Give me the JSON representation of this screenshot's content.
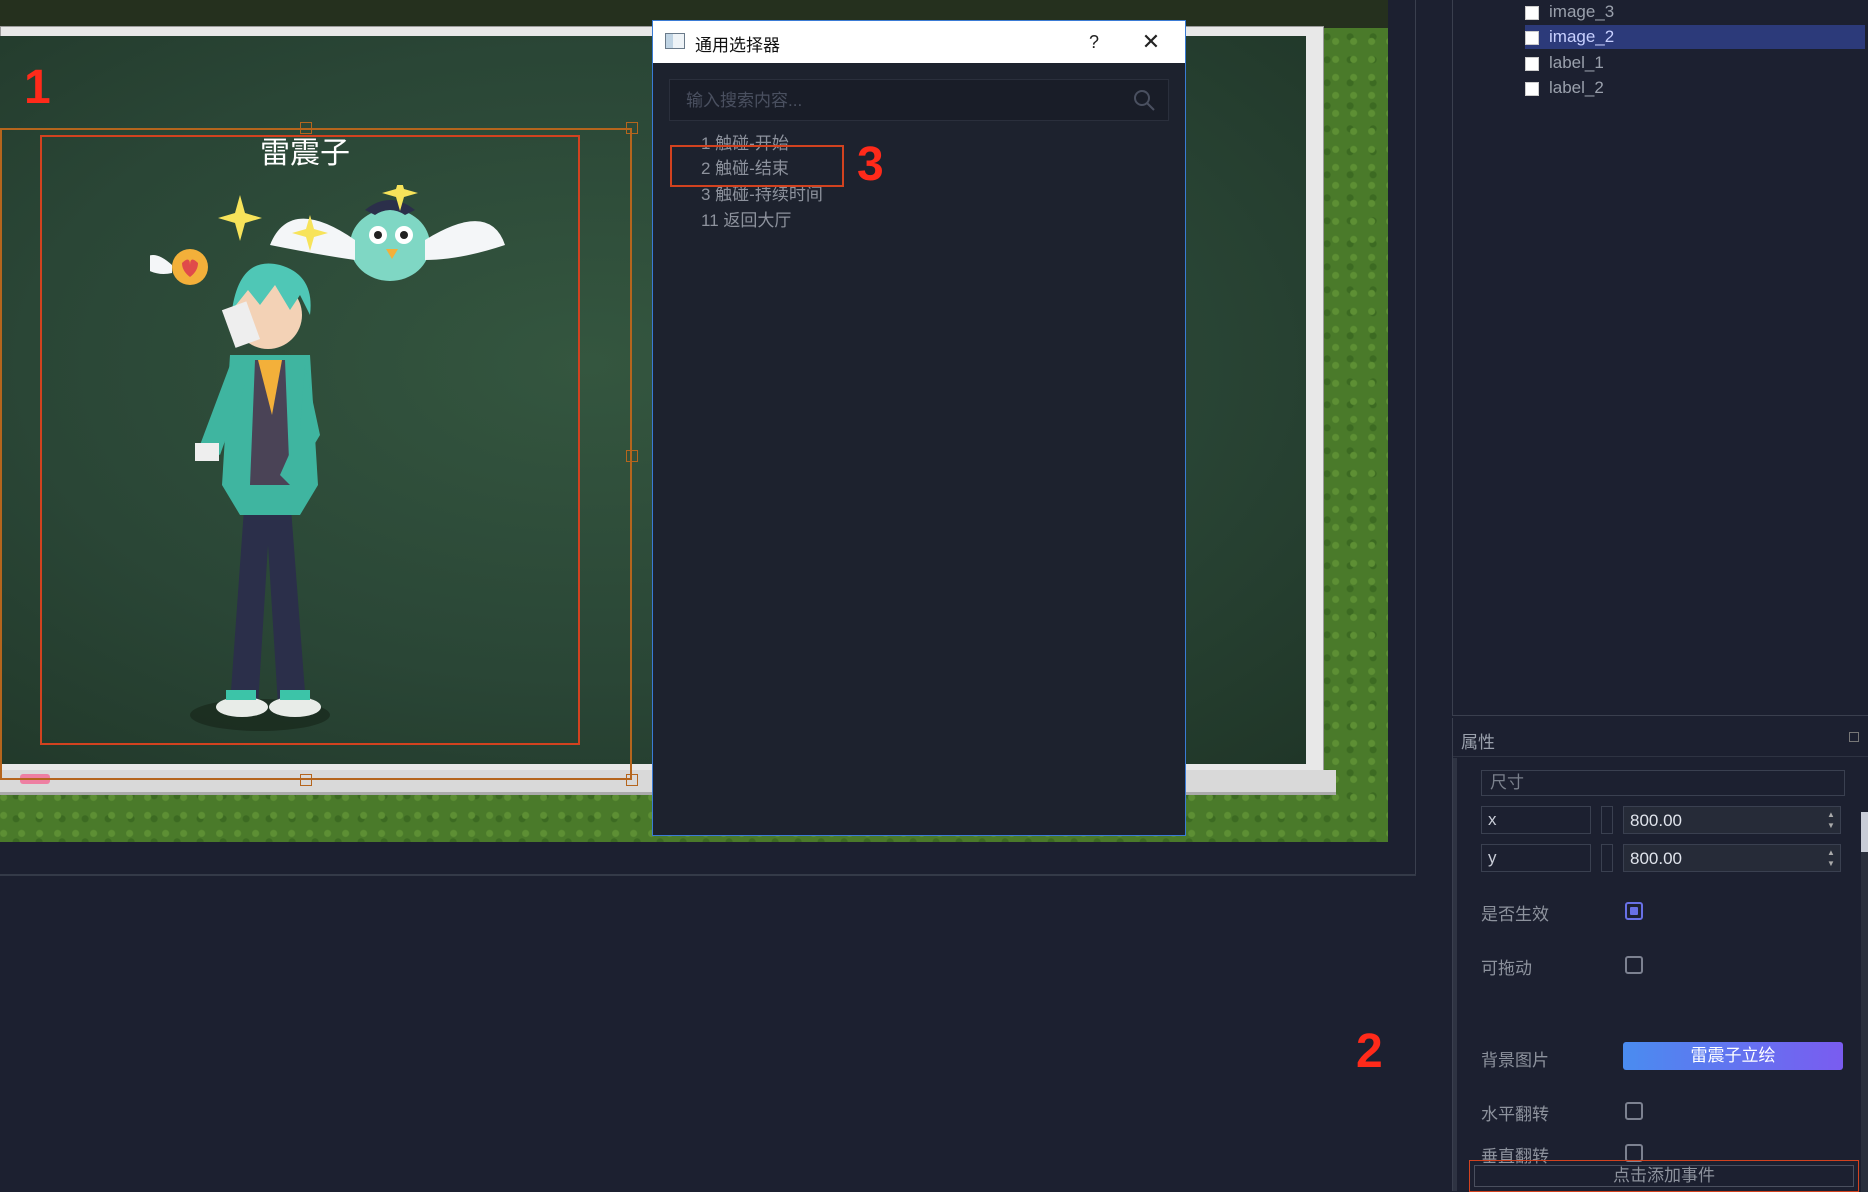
{
  "scene": {
    "character_name": "雷震子",
    "marker_1": "1"
  },
  "dialog": {
    "title": "通用选择器",
    "help_label": "?",
    "close_label": "✕",
    "search_placeholder": "输入搜索内容...",
    "items": [
      {
        "label": "1 触碰-开始"
      },
      {
        "label": "2 触碰-结束"
      },
      {
        "label": "3 触碰-持续时间"
      },
      {
        "label": "11 返回大厅"
      }
    ],
    "marker_3": "3"
  },
  "tree": {
    "items": [
      {
        "label": "image_3",
        "selected": false
      },
      {
        "label": "image_2",
        "selected": true
      },
      {
        "label": "label_1",
        "selected": false
      },
      {
        "label": "label_2",
        "selected": false
      }
    ]
  },
  "properties": {
    "title": "属性",
    "size_group": "尺寸",
    "x_label": "x",
    "x_value": "800.00",
    "y_label": "y",
    "y_value": "800.00",
    "enabled_label": "是否生效",
    "enabled": true,
    "draggable_label": "可拖动",
    "draggable": false,
    "bg_image_label": "背景图片",
    "bg_image_value": "雷震子立绘",
    "flip_h_label": "水平翻转",
    "flip_h": false,
    "flip_v_label": "垂直翻转",
    "flip_v": false,
    "add_event_label": "点击添加事件",
    "marker_2": "2"
  },
  "colors": {
    "accent": "#6870e6",
    "selection": "#2c3a7a",
    "marker": "#ff2a1a",
    "button_gradient_start": "#4a8cf0",
    "button_gradient_end": "#7a5cf0"
  }
}
